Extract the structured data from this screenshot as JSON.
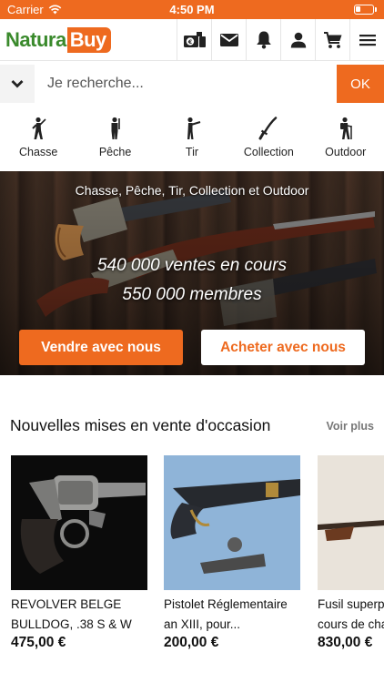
{
  "status_bar": {
    "carrier": "Carrier",
    "time": "4:50 PM"
  },
  "header": {
    "logo_part1": "Natura",
    "logo_part2": "Buy",
    "icons": [
      "sell-currency-icon",
      "mail-icon",
      "bell-icon",
      "user-icon",
      "cart-icon",
      "menu-icon"
    ]
  },
  "search": {
    "placeholder": "Je recherche...",
    "submit_label": "OK"
  },
  "categories": [
    {
      "label": "Chasse",
      "icon": "hunter-icon"
    },
    {
      "label": "Pêche",
      "icon": "fisherman-icon"
    },
    {
      "label": "Tir",
      "icon": "shooter-icon"
    },
    {
      "label": "Collection",
      "icon": "sword-icon"
    },
    {
      "label": "Outdoor",
      "icon": "hiker-icon"
    }
  ],
  "hero": {
    "tagline": "Chasse, Pêche, Tir, Collection et Outdoor",
    "stat_sales": "540 000 ventes en cours",
    "stat_members": "550 000 membres",
    "sell_label": "Vendre avec nous",
    "buy_label": "Acheter avec nous"
  },
  "listings": {
    "section_title": "Nouvelles mises en vente d'occasion",
    "see_more_label": "Voir plus",
    "items": [
      {
        "title": "REVOLVER BELGE BULLDOG, .38 S & W",
        "price": "475,00 €"
      },
      {
        "title": "Pistolet Réglementaire an XIII, pour...",
        "price": "200,00 €"
      },
      {
        "title": "Fusil superposé en cours de change...",
        "price": "830,00 €"
      }
    ]
  },
  "colors": {
    "accent": "#ee6a1f",
    "logo_green": "#3a8a2c"
  }
}
